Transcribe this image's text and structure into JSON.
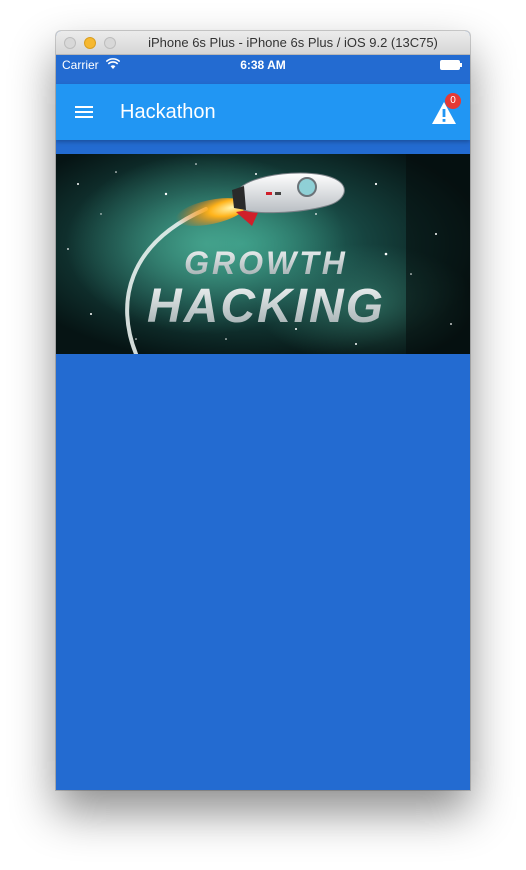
{
  "window": {
    "title": "iPhone 6s Plus - iPhone 6s Plus / iOS 9.2 (13C75)"
  },
  "status_bar": {
    "carrier": "Carrier",
    "time": "6:38 AM"
  },
  "app_bar": {
    "title": "Hackathon",
    "alert_count": "0"
  },
  "hero": {
    "line1": "GROWTH",
    "line2": "HACKING"
  },
  "colors": {
    "app_bar": "#2196f3",
    "background": "#236bd1",
    "badge": "#e53935"
  },
  "icons": [
    "menu-icon",
    "alert-icon",
    "wifi-icon",
    "battery-icon",
    "rocket-icon"
  ]
}
